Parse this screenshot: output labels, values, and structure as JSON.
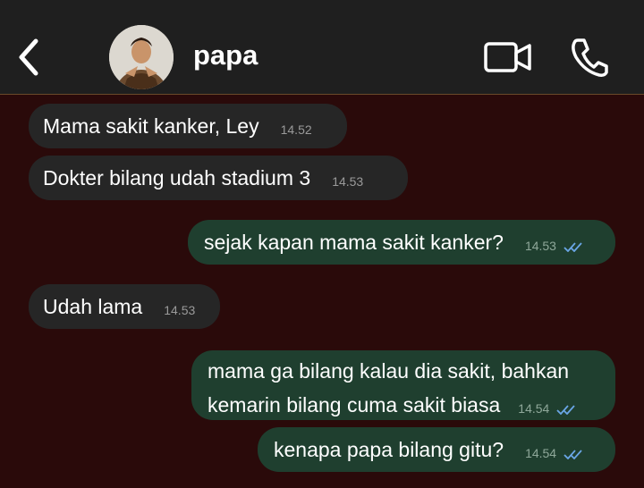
{
  "header": {
    "contact_name": "papa",
    "icons": {
      "back": "chevron-left-icon",
      "video": "video-camera-icon",
      "call": "phone-icon"
    }
  },
  "messages": [
    {
      "direction": "in",
      "text": "Mama sakit kanker, Ley",
      "time": "14.52"
    },
    {
      "direction": "in",
      "text": "Dokter bilang udah stadium 3",
      "time": "14.53"
    },
    {
      "direction": "out",
      "text": "sejak kapan mama sakit kanker?",
      "time": "14.53",
      "status": "read"
    },
    {
      "direction": "in",
      "text": "Udah lama",
      "time": "14.53"
    },
    {
      "direction": "out",
      "lines": [
        "mama ga bilang kalau dia sakit, bahkan",
        "kemarin bilang cuma sakit biasa"
      ],
      "time": "14.54",
      "status": "read"
    },
    {
      "direction": "out",
      "text": "kenapa papa bilang gitu?",
      "time": "14.54",
      "status": "read"
    }
  ],
  "colors": {
    "background": "#2a0a0a",
    "header": "#1f1f1f",
    "incoming_bubble": "#262626",
    "outgoing_bubble": "#1f3f2f",
    "read_ticks": "#6aa6e6"
  }
}
